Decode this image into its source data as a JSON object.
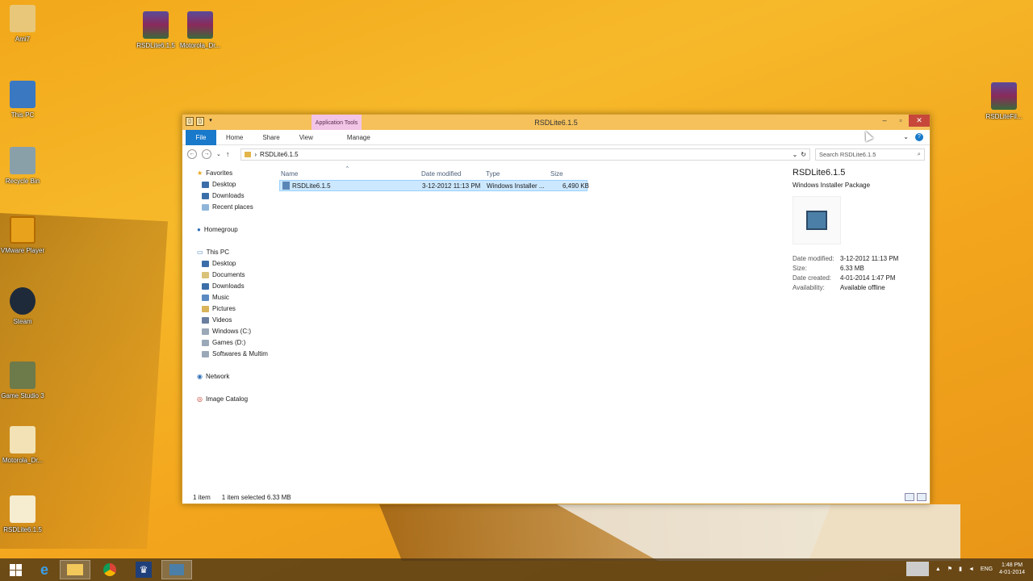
{
  "desktop": {
    "icons": [
      {
        "label": "Ami7"
      },
      {
        "label": "This PC"
      },
      {
        "label": "Recycle Bin"
      },
      {
        "label": "VMware Player"
      },
      {
        "label": "Steam"
      },
      {
        "label": "Game Studio 3"
      },
      {
        "label": "Motorola_Dr..."
      },
      {
        "label": "RSDLite6.1.5"
      },
      {
        "label": "RSDLite6.1.5"
      },
      {
        "label": "Motorola_Dr..."
      },
      {
        "label": "RSDLiteFil..."
      }
    ]
  },
  "window": {
    "title": "RSDLite6.1.5",
    "context_tab": "Application Tools",
    "ribbon": {
      "file": "File",
      "home": "Home",
      "share": "Share",
      "view": "View",
      "manage": "Manage"
    },
    "address": {
      "path": "RSDLite6.1.5",
      "search_placeholder": "Search RSDLite6.1.5"
    },
    "nav": {
      "favorites": "Favorites",
      "fav_items": [
        "Desktop",
        "Downloads",
        "Recent places"
      ],
      "homegroup": "Homegroup",
      "thispc": "This PC",
      "pc_items": [
        "Desktop",
        "Documents",
        "Downloads",
        "Music",
        "Pictures",
        "Videos",
        "Windows (C:)",
        "Games (D:)",
        "Softwares & Multim"
      ],
      "network": "Network",
      "image_catalog": "Image Catalog"
    },
    "columns": {
      "name": "Name",
      "date": "Date modified",
      "type": "Type",
      "size": "Size"
    },
    "file": {
      "name": "RSDLite6.1.5",
      "date": "3-12-2012 11:13 PM",
      "type": "Windows Installer ...",
      "size": "6,490 KB"
    },
    "details": {
      "name": "RSDLite6.1.5",
      "kind": "Windows Installer Package",
      "date_modified_label": "Date modified:",
      "date_modified": "3-12-2012 11:13 PM",
      "size_label": "Size:",
      "size": "6.33 MB",
      "date_created_label": "Date created:",
      "date_created": "4-01-2014 1:47 PM",
      "availability_label": "Availability:",
      "availability": "Available offline"
    },
    "status": {
      "count": "1 item",
      "selected": "1 item selected  6.33 MB"
    }
  },
  "taskbar": {
    "lang": "ENG",
    "time": "1:48 PM",
    "date": "4-01-2014"
  },
  "colors": {
    "accent": "#1979ca",
    "titlebar": "#f6c15b",
    "selection": "#cce8ff"
  }
}
